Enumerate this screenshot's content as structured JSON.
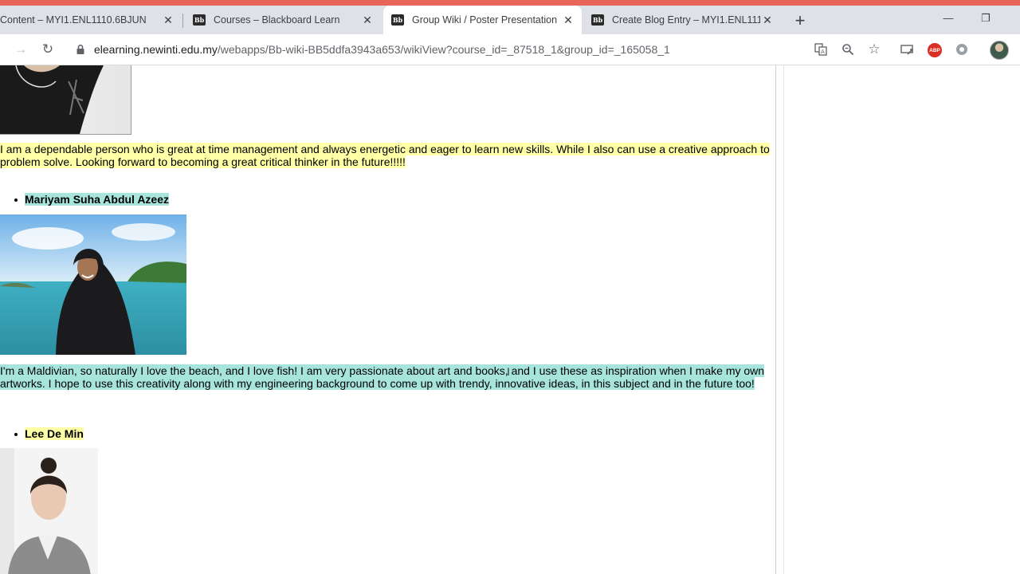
{
  "browser": {
    "tabs": [
      {
        "label": "Content – MYI1.ENL1110.6BJUN",
        "active": false
      },
      {
        "label": "Courses – Blackboard Learn",
        "active": false
      },
      {
        "label": "Group Wiki / Poster Presentation",
        "active": true
      },
      {
        "label": "Create Blog Entry – MYI1.ENL111",
        "active": false
      }
    ],
    "favicon_text": "Bb",
    "address": {
      "domain": "elearning.newinti.edu.my",
      "path": "/webapps/Bb-wiki-BB5ddfa3943a653/wikiView?course_id=_87518_1&group_id=_165058_1"
    },
    "extension_abp_label": "ABP"
  },
  "page": {
    "para1": "I am a dependable person who is great at time management and always energetic and eager to learn new skills. While I also can use a creative approach to problem solve. Looking forward to becoming a great critical thinker in the future!!!!!",
    "member2_name": "Mariyam Suha Abdul Azeez",
    "para2": "I'm a Maldivian,  so naturally I love the beach, and I love fish! I am very passionate about art and books, and I use these as inspiration when I make my own artworks. I hope to use this creativity along with my engineering background to come up with trendy, innovative ideas, in this subject and in the future too!",
    "member3_name": "Lee De Min"
  },
  "colors": {
    "highlight_yellow": "#ffffa8",
    "highlight_teal": "#a6e4dc",
    "accent_strip": "#e8655a"
  }
}
